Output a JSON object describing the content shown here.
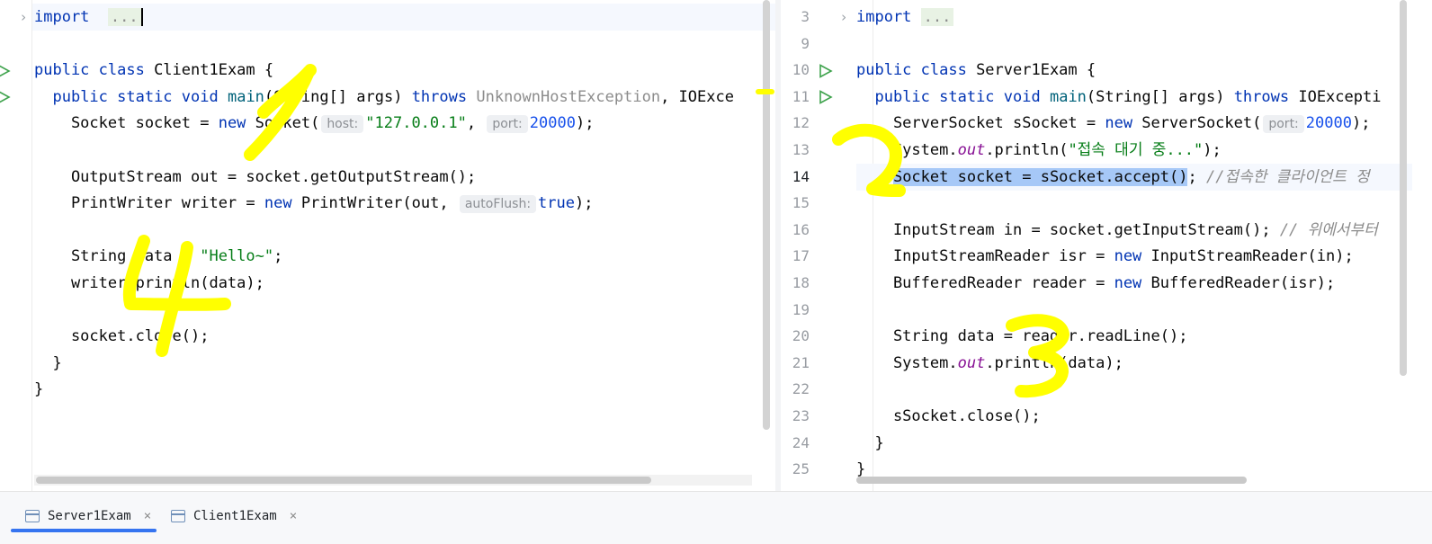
{
  "left_editor": {
    "lines": [
      {
        "segs": [
          [
            "kw",
            "import"
          ],
          [
            "",
            "  "
          ],
          [
            "fold",
            "..."
          ]
        ]
      },
      {
        "segs": []
      },
      {
        "segs": [
          [
            "kw",
            "public class"
          ],
          [
            "",
            " Client1Exam {"
          ]
        ]
      },
      {
        "segs": [
          [
            "",
            "  "
          ],
          [
            "kw",
            "public static void"
          ],
          [
            "",
            " "
          ],
          [
            "fn",
            "main"
          ],
          [
            "",
            "(String[] args) "
          ],
          [
            "kw",
            "throws"
          ],
          [
            "",
            " "
          ],
          [
            "gray",
            "UnknownHostException"
          ],
          [
            "",
            ", IOExce"
          ]
        ]
      },
      {
        "segs": [
          [
            "",
            "    Socket socket = "
          ],
          [
            "kw",
            "new"
          ],
          [
            "",
            " Socket("
          ],
          [
            "hint",
            "host:"
          ],
          [
            "str",
            "\"127.0.0.1\""
          ],
          [
            "",
            ", "
          ],
          [
            "hint",
            "port:"
          ],
          [
            "num",
            "20000"
          ],
          [
            "",
            ");"
          ]
        ]
      },
      {
        "segs": []
      },
      {
        "segs": [
          [
            "",
            "    OutputStream out = socket.getOutputStream();"
          ]
        ]
      },
      {
        "segs": [
          [
            "",
            "    PrintWriter writer = "
          ],
          [
            "kw",
            "new"
          ],
          [
            "",
            " PrintWriter(out, "
          ],
          [
            "hint",
            "autoFlush:"
          ],
          [
            "kw",
            "true"
          ],
          [
            "",
            ");"
          ]
        ]
      },
      {
        "segs": []
      },
      {
        "segs": [
          [
            "",
            "    String data = "
          ],
          [
            "str",
            "\"Hello~\""
          ],
          [
            "",
            ";"
          ]
        ]
      },
      {
        "segs": [
          [
            "",
            "    writer.println(data);"
          ]
        ]
      },
      {
        "segs": []
      },
      {
        "segs": [
          [
            "",
            "    socket.close();"
          ]
        ]
      },
      {
        "segs": [
          [
            "",
            "  }"
          ]
        ]
      },
      {
        "segs": [
          [
            "",
            "}"
          ]
        ]
      }
    ]
  },
  "right_editor": {
    "line_numbers": [
      "3",
      "9",
      "10",
      "11",
      "12",
      "13",
      "14",
      "15",
      "16",
      "17",
      "18",
      "19",
      "20",
      "21",
      "22",
      "23",
      "24",
      "25"
    ],
    "active_line": "14",
    "lines": [
      {
        "segs": [
          [
            "kw",
            "import"
          ],
          [
            "",
            " "
          ],
          [
            "fold",
            "..."
          ]
        ]
      },
      {
        "segs": []
      },
      {
        "segs": [
          [
            "kw",
            "public class"
          ],
          [
            "",
            " Server1Exam {"
          ]
        ]
      },
      {
        "segs": [
          [
            "",
            "  "
          ],
          [
            "kw",
            "public static void"
          ],
          [
            "",
            " "
          ],
          [
            "fn",
            "main"
          ],
          [
            "",
            "(String[] args) "
          ],
          [
            "kw",
            "throws"
          ],
          [
            "",
            " IOExcepti"
          ]
        ]
      },
      {
        "segs": [
          [
            "",
            "    ServerSocket sSocket = "
          ],
          [
            "kw",
            "new"
          ],
          [
            "",
            " ServerSocket("
          ],
          [
            "hint",
            "port:"
          ],
          [
            "num",
            "20000"
          ],
          [
            "",
            ");"
          ]
        ]
      },
      {
        "segs": [
          [
            "",
            "    System."
          ],
          [
            "st",
            "out"
          ],
          [
            "",
            ".println("
          ],
          [
            "str",
            "\"접속 대기 중...\""
          ],
          [
            "",
            ");"
          ]
        ]
      },
      {
        "segs": [
          [
            "",
            "    "
          ],
          [
            "sel",
            "Socket socket = sSocket.accept()"
          ],
          [
            "",
            "; "
          ],
          [
            "cmt",
            "//접속한 클라이언트 정"
          ]
        ]
      },
      {
        "segs": []
      },
      {
        "segs": [
          [
            "",
            "    InputStream in = socket.getInputStream(); "
          ],
          [
            "cmt",
            "// 위에서부터"
          ]
        ]
      },
      {
        "segs": [
          [
            "",
            "    InputStreamReader isr = "
          ],
          [
            "kw",
            "new"
          ],
          [
            "",
            " InputStreamReader(in);"
          ]
        ]
      },
      {
        "segs": [
          [
            "",
            "    BufferedReader reader = "
          ],
          [
            "kw",
            "new"
          ],
          [
            "",
            " BufferedReader(isr);"
          ]
        ]
      },
      {
        "segs": []
      },
      {
        "segs": [
          [
            "",
            "    String data = reader.readLine();"
          ]
        ]
      },
      {
        "segs": [
          [
            "",
            "    System."
          ],
          [
            "st",
            "out"
          ],
          [
            "",
            ".println(data);"
          ]
        ]
      },
      {
        "segs": []
      },
      {
        "segs": [
          [
            "",
            "    sSocket.close();"
          ]
        ]
      },
      {
        "segs": [
          [
            "",
            "  }"
          ]
        ]
      },
      {
        "segs": [
          [
            "",
            "}"
          ]
        ]
      }
    ]
  },
  "tabs": [
    {
      "label": "Server1Exam",
      "close": "×",
      "active": true
    },
    {
      "label": "Client1Exam",
      "close": "×",
      "active": false
    }
  ],
  "annotation_color": "#ffff00"
}
